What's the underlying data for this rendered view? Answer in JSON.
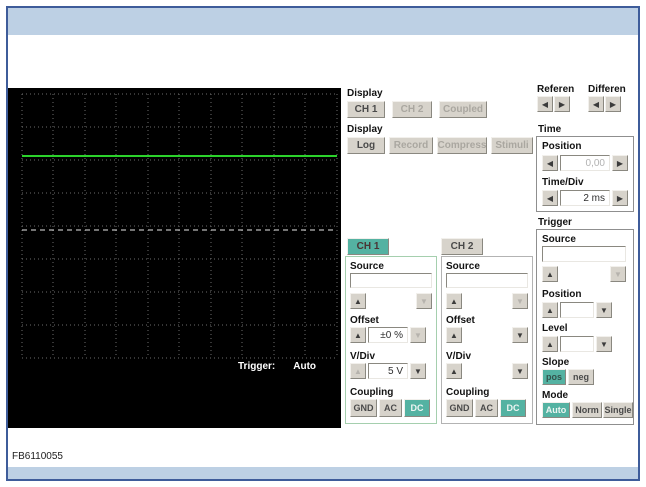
{
  "colors": {
    "frame_blue": "#3e5c9a",
    "band_blue": "#bdd0e4",
    "accent_teal": "#54b2a2",
    "trace_green": "#2bd22b",
    "scope_black": "#000000"
  },
  "icons": {
    "up": "▲",
    "down": "▼",
    "left": "◀",
    "right": "▶"
  },
  "footer": {
    "code": "FB6110055"
  },
  "scope": {
    "trigger_label": "Trigger:",
    "trigger_value": "Auto"
  },
  "display_channel": {
    "label": "Display",
    "buttons": [
      {
        "label": "CH 1",
        "enabled": true
      },
      {
        "label": "CH 2",
        "enabled": false
      },
      {
        "label": "Coupled",
        "enabled": false
      }
    ]
  },
  "display_mode": {
    "label": "Display",
    "buttons": [
      {
        "label": "Log",
        "enabled": true
      },
      {
        "label": "Record",
        "enabled": false
      },
      {
        "label": "Compress",
        "enabled": false
      },
      {
        "label": "Stimuli",
        "enabled": false
      }
    ]
  },
  "reference": {
    "label": "Referen"
  },
  "difference": {
    "label": "Differen"
  },
  "time": {
    "label": "Time",
    "position": {
      "label": "Position",
      "value": "0,00"
    },
    "time_div": {
      "label": "Time/Div",
      "value": "2 ms"
    }
  },
  "trigger": {
    "label": "Trigger",
    "source_label": "Source",
    "source_value": "",
    "position_label": "Position",
    "position_value": "",
    "level_label": "Level",
    "level_value": "",
    "slope_label": "Slope",
    "slope_options": [
      "pos",
      "neg"
    ],
    "slope_active": "pos",
    "mode_label": "Mode",
    "mode_options": [
      "Auto",
      "Norm",
      "Single"
    ],
    "mode_active": "Auto"
  },
  "channels": {
    "ch1": {
      "tab": "CH 1",
      "source_label": "Source",
      "source_value": "",
      "offset_label": "Offset",
      "offset_value": "±0 %",
      "vdiv_label": "V/Div",
      "vdiv_value": "5 V",
      "coupling_label": "Coupling",
      "coupling": [
        "GND",
        "AC",
        "DC"
      ],
      "coupling_active": "DC"
    },
    "ch2": {
      "tab": "CH 2",
      "source_label": "Source",
      "source_value": "",
      "offset_label": "Offset",
      "vdiv_label": "V/Div",
      "coupling_label": "Coupling",
      "coupling": [
        "GND",
        "AC",
        "DC"
      ],
      "coupling_active": "DC"
    }
  }
}
